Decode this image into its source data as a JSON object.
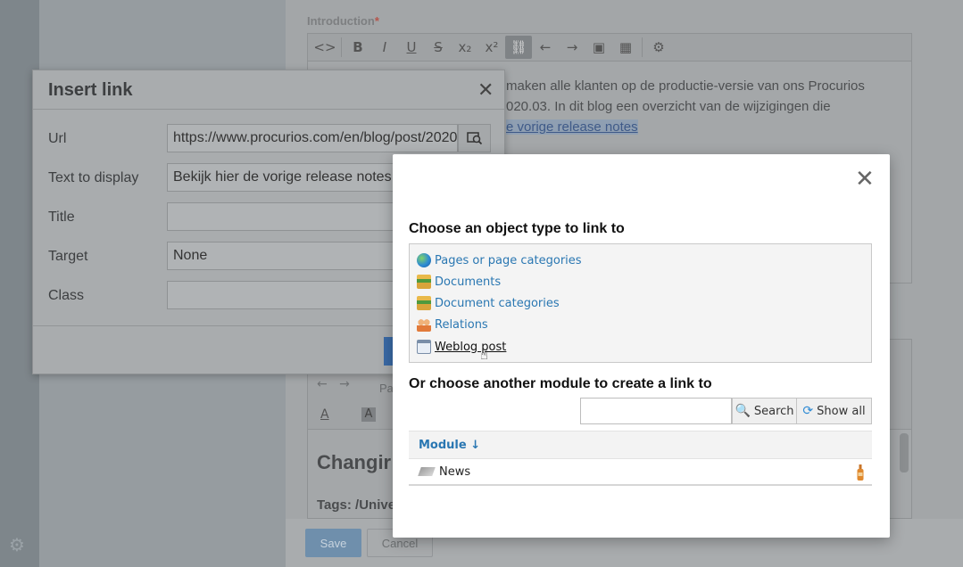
{
  "editor": {
    "intro_label": "Introduction",
    "required_mark": "*",
    "intro_text_line1": "maken alle klanten op de productie-versie van ons Procurios",
    "intro_text_line2": "020.03. In dit blog een overzicht van de wijzigingen die",
    "intro_link_text": "e vorige release notes",
    "paragraph_label": "Pa",
    "heading_text": "Changir",
    "tags_text": "Tags: /Unive",
    "save_label": "Save",
    "cancel_label": "Cancel"
  },
  "insert_link": {
    "title": "Insert link",
    "fields": [
      {
        "label": "Url",
        "value": "https://www.procurios.com/en/blog/post/2020"
      },
      {
        "label": "Text to display",
        "value": "Bekijk hier de vorige release notes"
      },
      {
        "label": "Title",
        "value": ""
      },
      {
        "label": "Target",
        "value": "None"
      },
      {
        "label": "Class",
        "value": ""
      }
    ]
  },
  "object_modal": {
    "heading1": "Choose an object type to link to",
    "types": [
      {
        "label": "Pages or page categories",
        "icon": "globe-icon",
        "color": "#2e8bd4"
      },
      {
        "label": "Documents",
        "icon": "books-icon",
        "color": "#d9a43b"
      },
      {
        "label": "Document categories",
        "icon": "books-icon",
        "color": "#d9a43b"
      },
      {
        "label": "Relations",
        "icon": "people-icon",
        "color": "#e27a3a"
      },
      {
        "label": "Weblog post",
        "icon": "calendar-icon",
        "color": "#7a8ea8"
      }
    ],
    "heading2": "Or choose another module to create a link to",
    "search_value": "",
    "search_label": "Search",
    "show_all_label": "Show all",
    "table": {
      "column": "Module",
      "rows": [
        {
          "name": "News"
        }
      ]
    }
  },
  "colors": {
    "accent": "#2a77b2",
    "primary_button": "#3a6aa6"
  }
}
